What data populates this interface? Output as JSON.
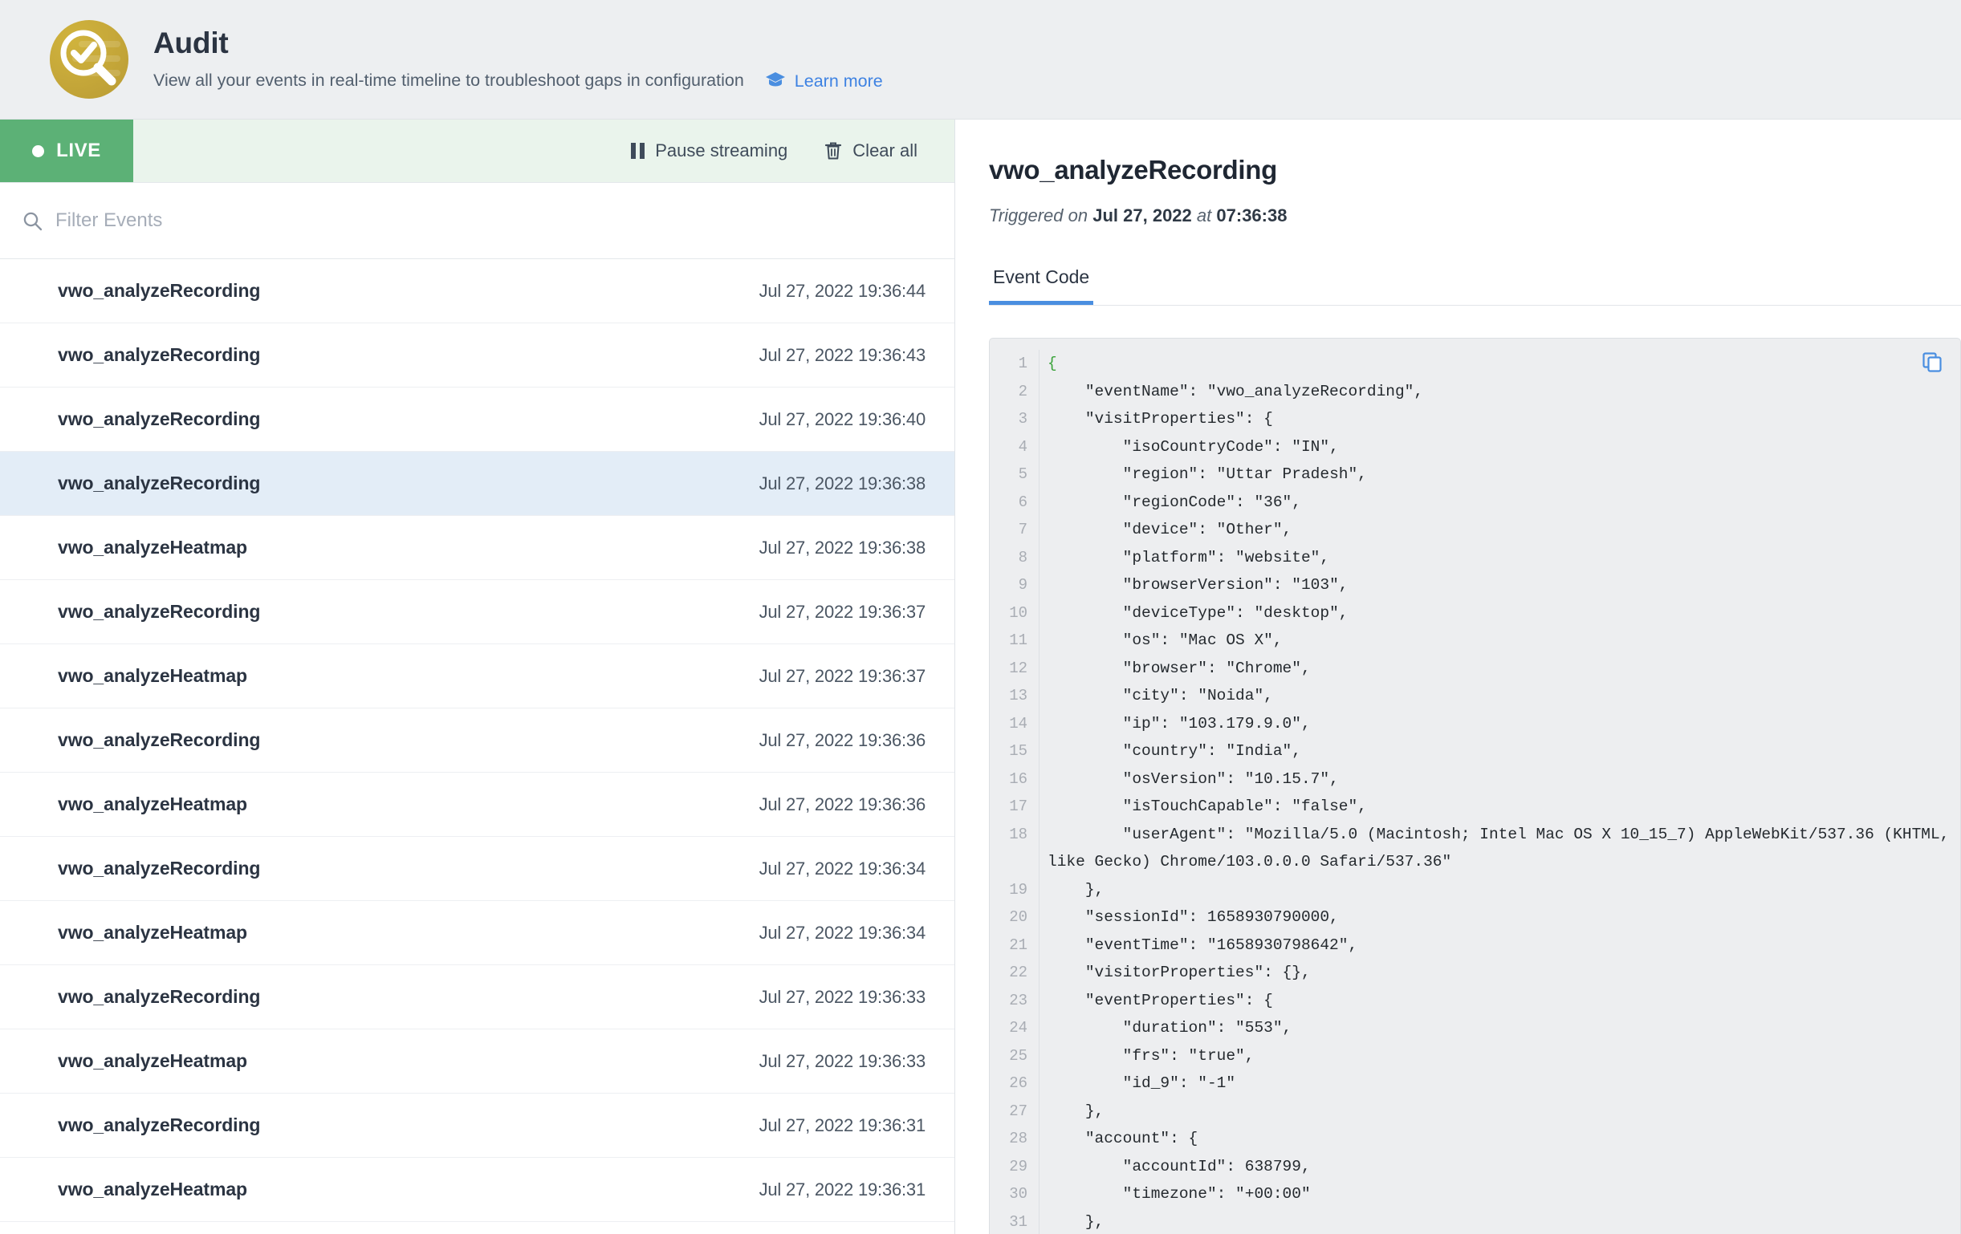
{
  "header": {
    "logo_icon": "audit-magnifier-check-icon",
    "title": "Audit",
    "subtitle": "View all your events in real-time timeline to troubleshoot gaps in configuration",
    "learn_more_label": "Learn more",
    "learn_more_icon": "graduation-cap-icon",
    "learn_more_color": "#3e82e2"
  },
  "stream_bar": {
    "live_label": "LIVE",
    "live_color": "#5CB176",
    "bar_background": "#EAF4EC",
    "pause_label": "Pause streaming",
    "pause_icon": "pause-icon",
    "clear_label": "Clear all",
    "clear_icon": "trash-icon"
  },
  "filter": {
    "icon": "search-icon",
    "value": "",
    "placeholder": "Filter Events"
  },
  "events": [
    {
      "name": "vwo_analyzeRecording",
      "time": "Jul 27, 2022 19:36:44",
      "selected": false
    },
    {
      "name": "vwo_analyzeRecording",
      "time": "Jul 27, 2022 19:36:43",
      "selected": false
    },
    {
      "name": "vwo_analyzeRecording",
      "time": "Jul 27, 2022 19:36:40",
      "selected": false
    },
    {
      "name": "vwo_analyzeRecording",
      "time": "Jul 27, 2022 19:36:38",
      "selected": true
    },
    {
      "name": "vwo_analyzeHeatmap",
      "time": "Jul 27, 2022 19:36:38",
      "selected": false
    },
    {
      "name": "vwo_analyzeRecording",
      "time": "Jul 27, 2022 19:36:37",
      "selected": false
    },
    {
      "name": "vwo_analyzeHeatmap",
      "time": "Jul 27, 2022 19:36:37",
      "selected": false
    },
    {
      "name": "vwo_analyzeRecording",
      "time": "Jul 27, 2022 19:36:36",
      "selected": false
    },
    {
      "name": "vwo_analyzeHeatmap",
      "time": "Jul 27, 2022 19:36:36",
      "selected": false
    },
    {
      "name": "vwo_analyzeRecording",
      "time": "Jul 27, 2022 19:36:34",
      "selected": false
    },
    {
      "name": "vwo_analyzeHeatmap",
      "time": "Jul 27, 2022 19:36:34",
      "selected": false
    },
    {
      "name": "vwo_analyzeRecording",
      "time": "Jul 27, 2022 19:36:33",
      "selected": false
    },
    {
      "name": "vwo_analyzeHeatmap",
      "time": "Jul 27, 2022 19:36:33",
      "selected": false
    },
    {
      "name": "vwo_analyzeRecording",
      "time": "Jul 27, 2022 19:36:31",
      "selected": false
    },
    {
      "name": "vwo_analyzeHeatmap",
      "time": "Jul 27, 2022 19:36:31",
      "selected": false
    }
  ],
  "detail": {
    "title": "vwo_analyzeRecording",
    "triggered_prefix": "Triggered on",
    "triggered_date": "Jul 27, 2022",
    "triggered_at_word": "at",
    "triggered_time": "07:36:38",
    "tab_label": "Event Code",
    "tab_accent_color": "#4a8ee0",
    "copy_icon": "copy-icon",
    "code_background": "#EDEEF0",
    "code_lines": [
      "{",
      "    \"eventName\": \"vwo_analyzeRecording\",",
      "    \"visitProperties\": {",
      "        \"isoCountryCode\": \"IN\",",
      "        \"region\": \"Uttar Pradesh\",",
      "        \"regionCode\": \"36\",",
      "        \"device\": \"Other\",",
      "        \"platform\": \"website\",",
      "        \"browserVersion\": \"103\",",
      "        \"deviceType\": \"desktop\",",
      "        \"os\": \"Mac OS X\",",
      "        \"browser\": \"Chrome\",",
      "        \"city\": \"Noida\",",
      "        \"ip\": \"103.179.9.0\",",
      "        \"country\": \"India\",",
      "        \"osVersion\": \"10.15.7\",",
      "        \"isTouchCapable\": \"false\",",
      "        \"userAgent\": \"Mozilla/5.0 (Macintosh; Intel Mac OS X 10_15_7) AppleWebKit/537.36 (KHTML, like Gecko) Chrome/103.0.0.0 Safari/537.36\"",
      "    },",
      "    \"sessionId\": 1658930790000,",
      "    \"eventTime\": \"1658930798642\",",
      "    \"visitorProperties\": {},",
      "    \"eventProperties\": {",
      "        \"duration\": \"553\",",
      "        \"frs\": \"true\",",
      "        \"id_9\": \"-1\"",
      "    },",
      "    \"account\": {",
      "        \"accountId\": 638799,",
      "        \"timezone\": \"+00:00\"",
      "    },"
    ]
  }
}
